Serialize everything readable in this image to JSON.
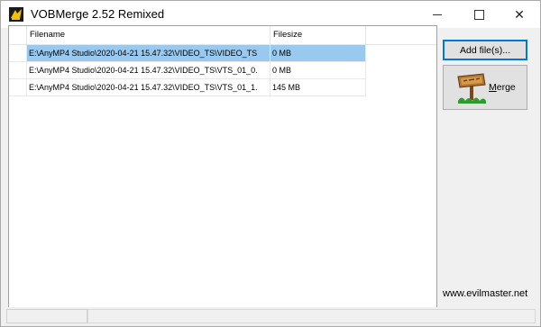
{
  "window": {
    "title": "VOBMerge 2.52 Remixed"
  },
  "file_list": {
    "columns": [
      "Filename",
      "Filesize"
    ],
    "rows": [
      {
        "filename": "E:\\AnyMP4 Studio\\2020-04-21 15.47.32\\VIDEO_TS\\VIDEO_TS",
        "filesize": "0 MB",
        "selected": true
      },
      {
        "filename": "E:\\AnyMP4 Studio\\2020-04-21 15.47.32\\VIDEO_TS\\VTS_01_0.",
        "filesize": "0 MB",
        "selected": false
      },
      {
        "filename": "E:\\AnyMP4 Studio\\2020-04-21 15.47.32\\VIDEO_TS\\VTS_01_1.",
        "filesize": "145 MB",
        "selected": false
      }
    ]
  },
  "actions": {
    "add_files_label": "Add file(s)...",
    "merge_label": "Merge"
  },
  "footer": {
    "website": "www.evilmaster.net"
  },
  "colors": {
    "selection": "#99c9ef",
    "focus_border": "#0078d7"
  }
}
